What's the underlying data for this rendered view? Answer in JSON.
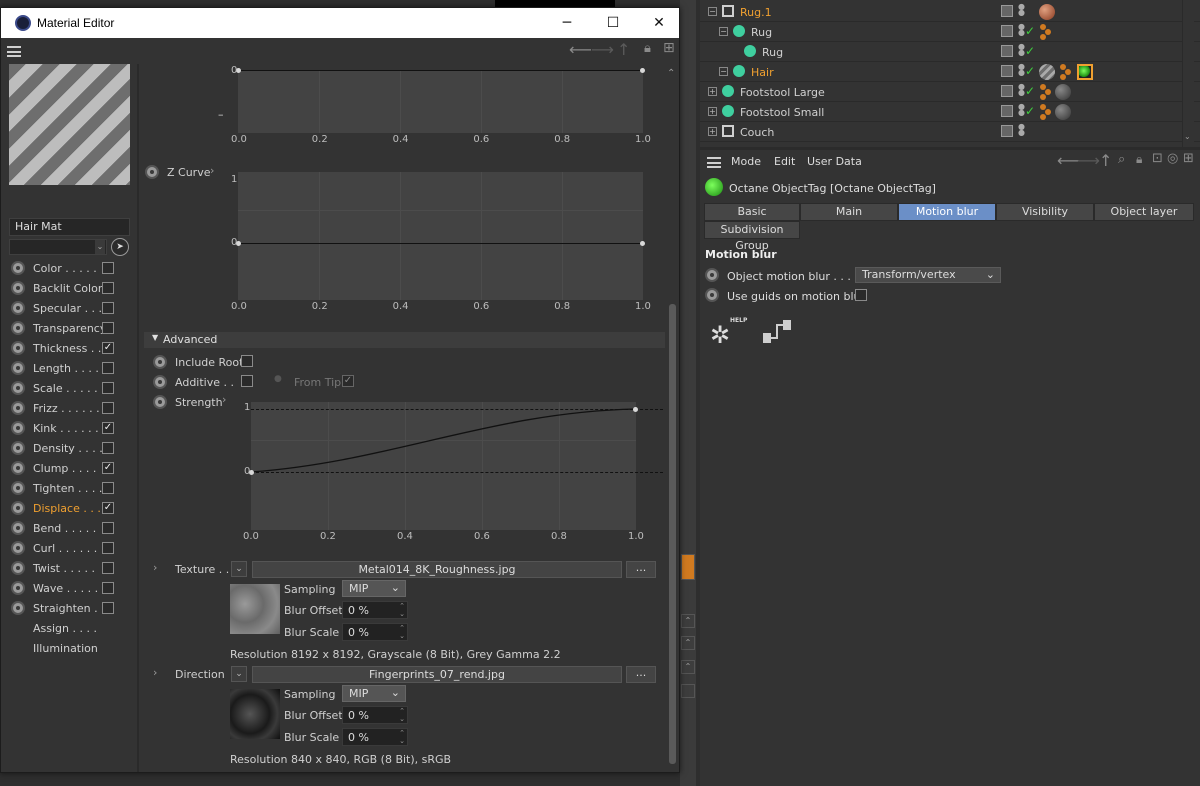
{
  "window": {
    "title": "Material Editor",
    "minimize": "─",
    "maximize": "☐",
    "close": "✕"
  },
  "material": {
    "name": "Hair Mat",
    "channels": [
      {
        "label": "Color . . . . .",
        "checked": false,
        "active": false,
        "has_radio": true
      },
      {
        "label": "Backlit Color",
        "checked": false,
        "active": false,
        "has_radio": true
      },
      {
        "label": "Specular . . .",
        "checked": false,
        "active": false,
        "has_radio": true
      },
      {
        "label": "Transparency",
        "checked": false,
        "active": false,
        "has_radio": true
      },
      {
        "label": "Thickness . .",
        "checked": true,
        "active": false,
        "has_radio": true
      },
      {
        "label": "Length . . . .",
        "checked": false,
        "active": false,
        "has_radio": true
      },
      {
        "label": "Scale . . . . .",
        "checked": false,
        "active": false,
        "has_radio": true
      },
      {
        "label": "Frizz . . . . . .",
        "checked": false,
        "active": false,
        "has_radio": true
      },
      {
        "label": "Kink . . . . . .",
        "checked": true,
        "active": false,
        "has_radio": true
      },
      {
        "label": "Density . . . .",
        "checked": false,
        "active": false,
        "has_radio": true
      },
      {
        "label": "Clump . . . .",
        "checked": true,
        "active": false,
        "has_radio": true
      },
      {
        "label": "Tighten . . . .",
        "checked": false,
        "active": false,
        "has_radio": true
      },
      {
        "label": "Displace . . .",
        "checked": true,
        "active": true,
        "has_radio": true
      },
      {
        "label": "Bend . . . . .",
        "checked": false,
        "active": false,
        "has_radio": true
      },
      {
        "label": "Curl . . . . . .",
        "checked": false,
        "active": false,
        "has_radio": true
      },
      {
        "label": "Twist . . . . .",
        "checked": false,
        "active": false,
        "has_radio": true
      },
      {
        "label": "Wave . . . . .",
        "checked": false,
        "active": false,
        "has_radio": true
      },
      {
        "label": "Straighten . .",
        "checked": false,
        "active": false,
        "has_radio": true
      },
      {
        "label": "Assign . . . .",
        "checked": null,
        "active": false,
        "has_radio": false
      },
      {
        "label": "Illumination",
        "checked": null,
        "active": false,
        "has_radio": false
      }
    ]
  },
  "graphs": {
    "ticks_x": [
      "0.0",
      "0.2",
      "0.4",
      "0.6",
      "0.8",
      "1.0"
    ],
    "top": {
      "y_label": "0"
    },
    "z_curve": {
      "label": "Z Curve",
      "y_ticks": [
        "1",
        "0"
      ]
    },
    "strength": {
      "label": "Strength",
      "y_ticks": [
        "1",
        "0"
      ]
    }
  },
  "advanced": {
    "header": "Advanced",
    "include_root": {
      "label": "Include Root",
      "checked": false
    },
    "additive": {
      "label": "Additive . .",
      "checked": false
    },
    "from_tip": {
      "label": "From Tip",
      "checked": true
    }
  },
  "texture": {
    "label": "Texture . .",
    "file": "Metal014_8K_Roughness.jpg",
    "browse": "...",
    "sampling_label": "Sampling",
    "sampling_value": "MIP",
    "blur_offset_label": "Blur Offset",
    "blur_offset_value": "0 %",
    "blur_scale_label": "Blur Scale",
    "blur_scale_value": "0 %",
    "resolution": "Resolution 8192 x 8192, Grayscale (8 Bit), Grey Gamma 2.2"
  },
  "direction": {
    "label": "Direction",
    "file": "Fingerprints_07_rend.jpg",
    "browse": "...",
    "sampling_label": "Sampling",
    "sampling_value": "MIP",
    "blur_offset_label": "Blur Offset",
    "blur_offset_value": "0 %",
    "blur_scale_label": "Blur Scale",
    "blur_scale_value": "0 %",
    "resolution": "Resolution 840 x 840, RGB (8 Bit), sRGB"
  },
  "objects": [
    {
      "name": "Rug.1",
      "orange": true,
      "indent": 0
    },
    {
      "name": "Rug",
      "orange": false,
      "indent": 1
    },
    {
      "name": "Rug",
      "orange": false,
      "indent": 2
    },
    {
      "name": "Hair",
      "orange": true,
      "indent": 1
    },
    {
      "name": "Footstool Large",
      "orange": false,
      "indent": 0
    },
    {
      "name": "Footstool Small",
      "orange": false,
      "indent": 0
    },
    {
      "name": "Couch",
      "orange": false,
      "indent": 0
    }
  ],
  "attr": {
    "menu": [
      "Mode",
      "Edit",
      "User Data"
    ],
    "tag_title": "Octane ObjectTag [Octane ObjectTag]",
    "tabs": [
      "Basic",
      "Main",
      "Motion blur",
      "Visibility",
      "Object layer"
    ],
    "active_tab": "Motion blur",
    "tab2": "Subdivision Group",
    "section": "Motion blur",
    "object_motion_blur_label": "Object motion blur . . . .",
    "object_motion_blur_value": "Transform/vertex",
    "use_guids_label": "Use guids on motion blur",
    "help_label": "HELP"
  },
  "colors": {
    "accent": "#6b8fc7",
    "active_channel": "#f0a030"
  }
}
